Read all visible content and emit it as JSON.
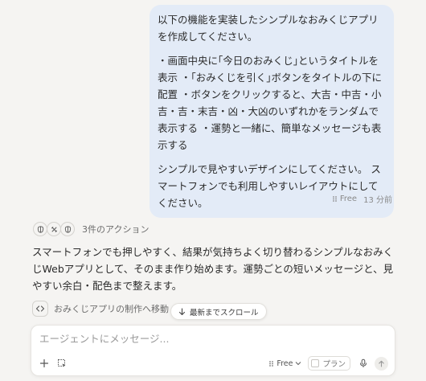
{
  "user_message": {
    "paragraphs": [
      "以下の機能を実装したシンプルなおみくじアプリを作成してください。",
      "・画面中央に｢今日のおみくじ｣というタイトルを表示 ・｢おみくじを引く｣ボタンをタイトルの下に配置 ・ボタンをクリックすると、大吉・中吉・小吉・吉・末吉・凶・大凶のいずれかをランダムで表示する ・運勢と一緒に、簡単なメッセージも表示する",
      "シンプルで見やすいデザインにしてください。 スマートフォンでも利用しやすいレイアウトにしてください。"
    ],
    "plan_label": "Free",
    "timestamp": "13 分前"
  },
  "actions": {
    "label": "3件のアクション",
    "icons": [
      "brain-icon",
      "tools-icon",
      "brain-icon"
    ]
  },
  "assistant": {
    "text": "スマートフォンでも押しやすく、結果が気持ちよく切り替わるシンプルなおみくじWebアプリとして、そのまま作り始めます。運勢ごとの短いメッセージと、見やすい余白・配色まで整えます。"
  },
  "task": {
    "label": "おみくじアプリの制作へ移動"
  },
  "scroll_button": {
    "label": "最新までスクロール"
  },
  "composer": {
    "placeholder": "エージェントにメッセージ...",
    "plan_select": "Free",
    "plan_toggle": "プラン"
  },
  "colors": {
    "background": "#f5f4f2",
    "user_bubble": "#e3ebf7"
  }
}
